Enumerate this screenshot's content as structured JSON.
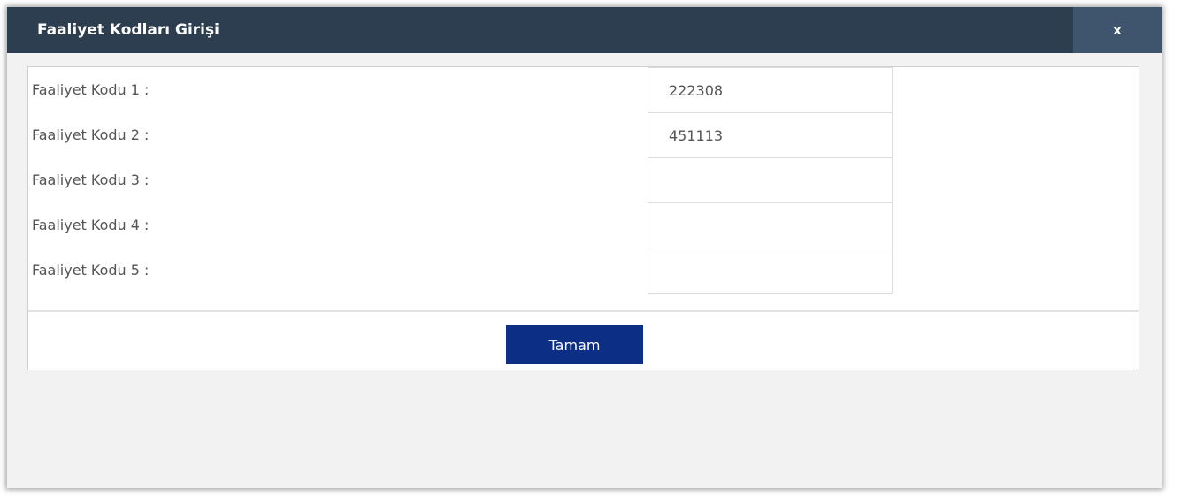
{
  "dialog": {
    "title": "Faaliyet Kodları Girişi",
    "close_label": "x"
  },
  "form": {
    "rows": [
      {
        "label": "Faaliyet Kodu 1 :",
        "value": "222308"
      },
      {
        "label": "Faaliyet Kodu 2 :",
        "value": "451113"
      },
      {
        "label": "Faaliyet Kodu 3 :",
        "value": ""
      },
      {
        "label": "Faaliyet Kodu 4 :",
        "value": ""
      },
      {
        "label": "Faaliyet Kodu 5 :",
        "value": ""
      }
    ]
  },
  "footer": {
    "ok_label": "Tamam"
  },
  "colors": {
    "titlebar": "#2d3e50",
    "close_button": "#3e556d",
    "ok_button": "#0d2e85"
  }
}
